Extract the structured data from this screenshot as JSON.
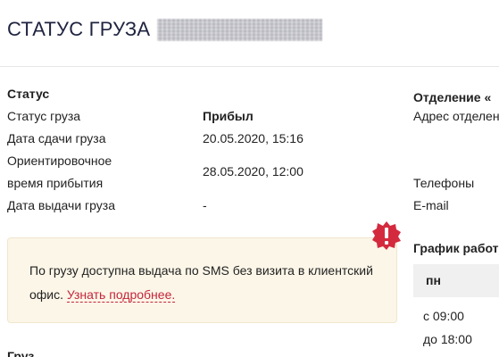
{
  "page": {
    "title": "СТАТУС ГРУЗА",
    "tracking_number_redacted": true
  },
  "status_section": {
    "heading": "Статус",
    "rows": [
      {
        "label": "Статус груза",
        "value": "Прибыл",
        "bold": true
      },
      {
        "label": "Дата сдачи груза",
        "value": "20.05.2020, 15:16",
        "bold": false
      },
      {
        "label": "Ориентировочное время прибытия",
        "label_line1": "Ориентировочное",
        "label_line2": "время прибытия",
        "value": "28.05.2020, 12:00",
        "bold": false
      },
      {
        "label": "Дата выдачи груза",
        "value": "-",
        "bold": false
      }
    ]
  },
  "notice": {
    "text": "По грузу доступна выдача по SMS без визита в клиентский офис.",
    "link_label": "Узнать подробнее.",
    "accent_color": "#c4253b",
    "background_color": "#fcf6e8",
    "icon": "warning-exclamation-icon"
  },
  "office_section": {
    "heading": "Отделение «",
    "address_label": "Адрес отделен",
    "phones_label": "Телефоны",
    "email_label": "E-mail"
  },
  "schedule": {
    "heading": "График работ",
    "day": "пн",
    "from": "с 09:00",
    "to": "до 18:00"
  },
  "cargo_section": {
    "heading": "Груз"
  }
}
